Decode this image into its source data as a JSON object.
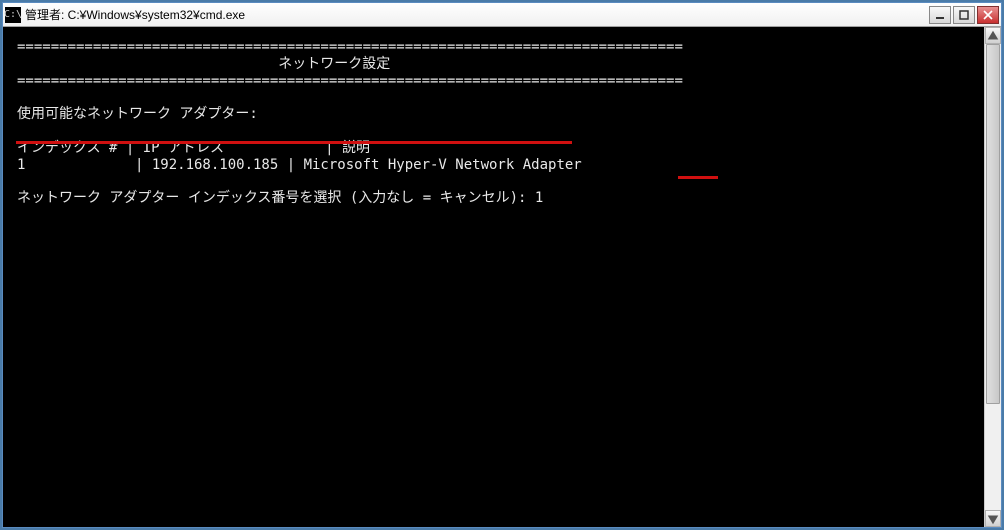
{
  "window": {
    "icon_label": "C:\\",
    "title": "管理者: C:¥Windows¥system32¥cmd.exe"
  },
  "console": {
    "divider": "===============================================================================",
    "heading_prefix": "                               ",
    "heading": "ネットワーク設定",
    "blank": "",
    "adapters_label": "使用可能なネットワーク アダプター:",
    "table_header": "インデックス # | IP アドレス            | 説明",
    "table_row_1": "1             | 192.168.100.185 | Microsoft Hyper-V Network Adapter",
    "prompt_line": "ネットワーク アダプター インデックス番号を選択 (入力なし = キャンセル): 1"
  },
  "adapters": [
    {
      "index": "1",
      "ip": "192.168.100.185",
      "description": "Microsoft Hyper-V Network Adapter"
    }
  ],
  "prompt": {
    "input_value": "1"
  }
}
